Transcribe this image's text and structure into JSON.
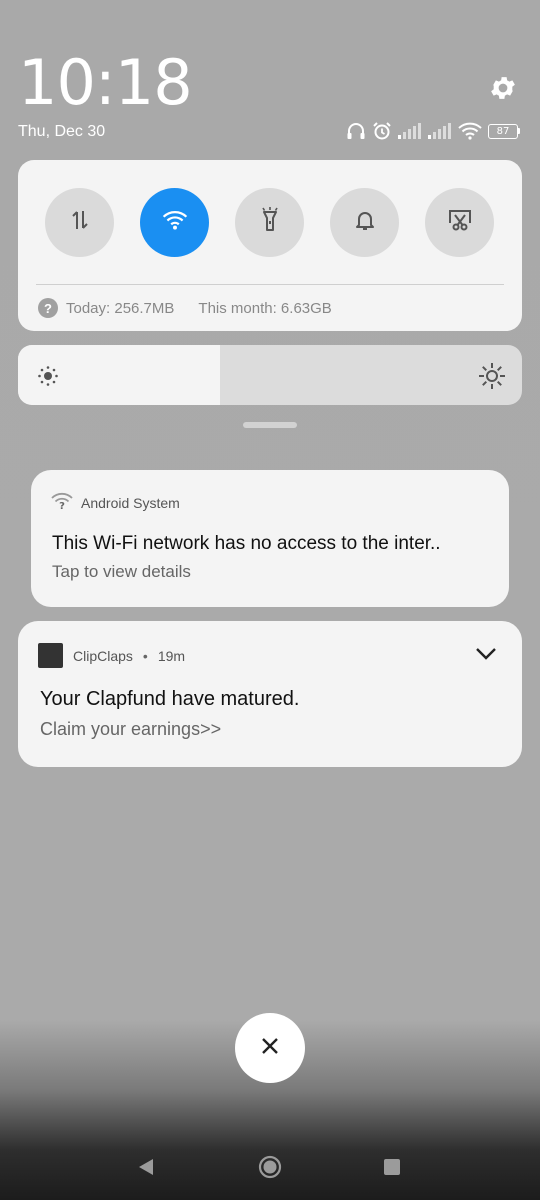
{
  "header": {
    "time": "10:18",
    "date": "Thu, Dec 30",
    "battery": "87"
  },
  "quick_settings": {
    "tiles": [
      {
        "name": "mobile-data",
        "icon": "data-transfer-icon",
        "active": false
      },
      {
        "name": "wifi",
        "icon": "wifi-icon",
        "active": true
      },
      {
        "name": "flashlight",
        "icon": "flashlight-icon",
        "active": false
      },
      {
        "name": "sound",
        "icon": "bell-icon",
        "active": false
      },
      {
        "name": "screenshot",
        "icon": "scissors-screen-icon",
        "active": false
      }
    ],
    "data_today": "Today: 256.7MB",
    "data_month": "This month: 6.63GB",
    "brightness_level": 0.4
  },
  "notifications": [
    {
      "app": "Android System",
      "title": "This Wi-Fi network has no access to the inter..",
      "text": "Tap to view details"
    },
    {
      "app": "ClipClaps",
      "time": "19m",
      "title": "Your Clapfund have matured.",
      "text": "Claim your earnings>>"
    }
  ],
  "colors": {
    "accent": "#1a8ff2",
    "panel": "#f4f4f4",
    "background": "#aaaaaa"
  }
}
